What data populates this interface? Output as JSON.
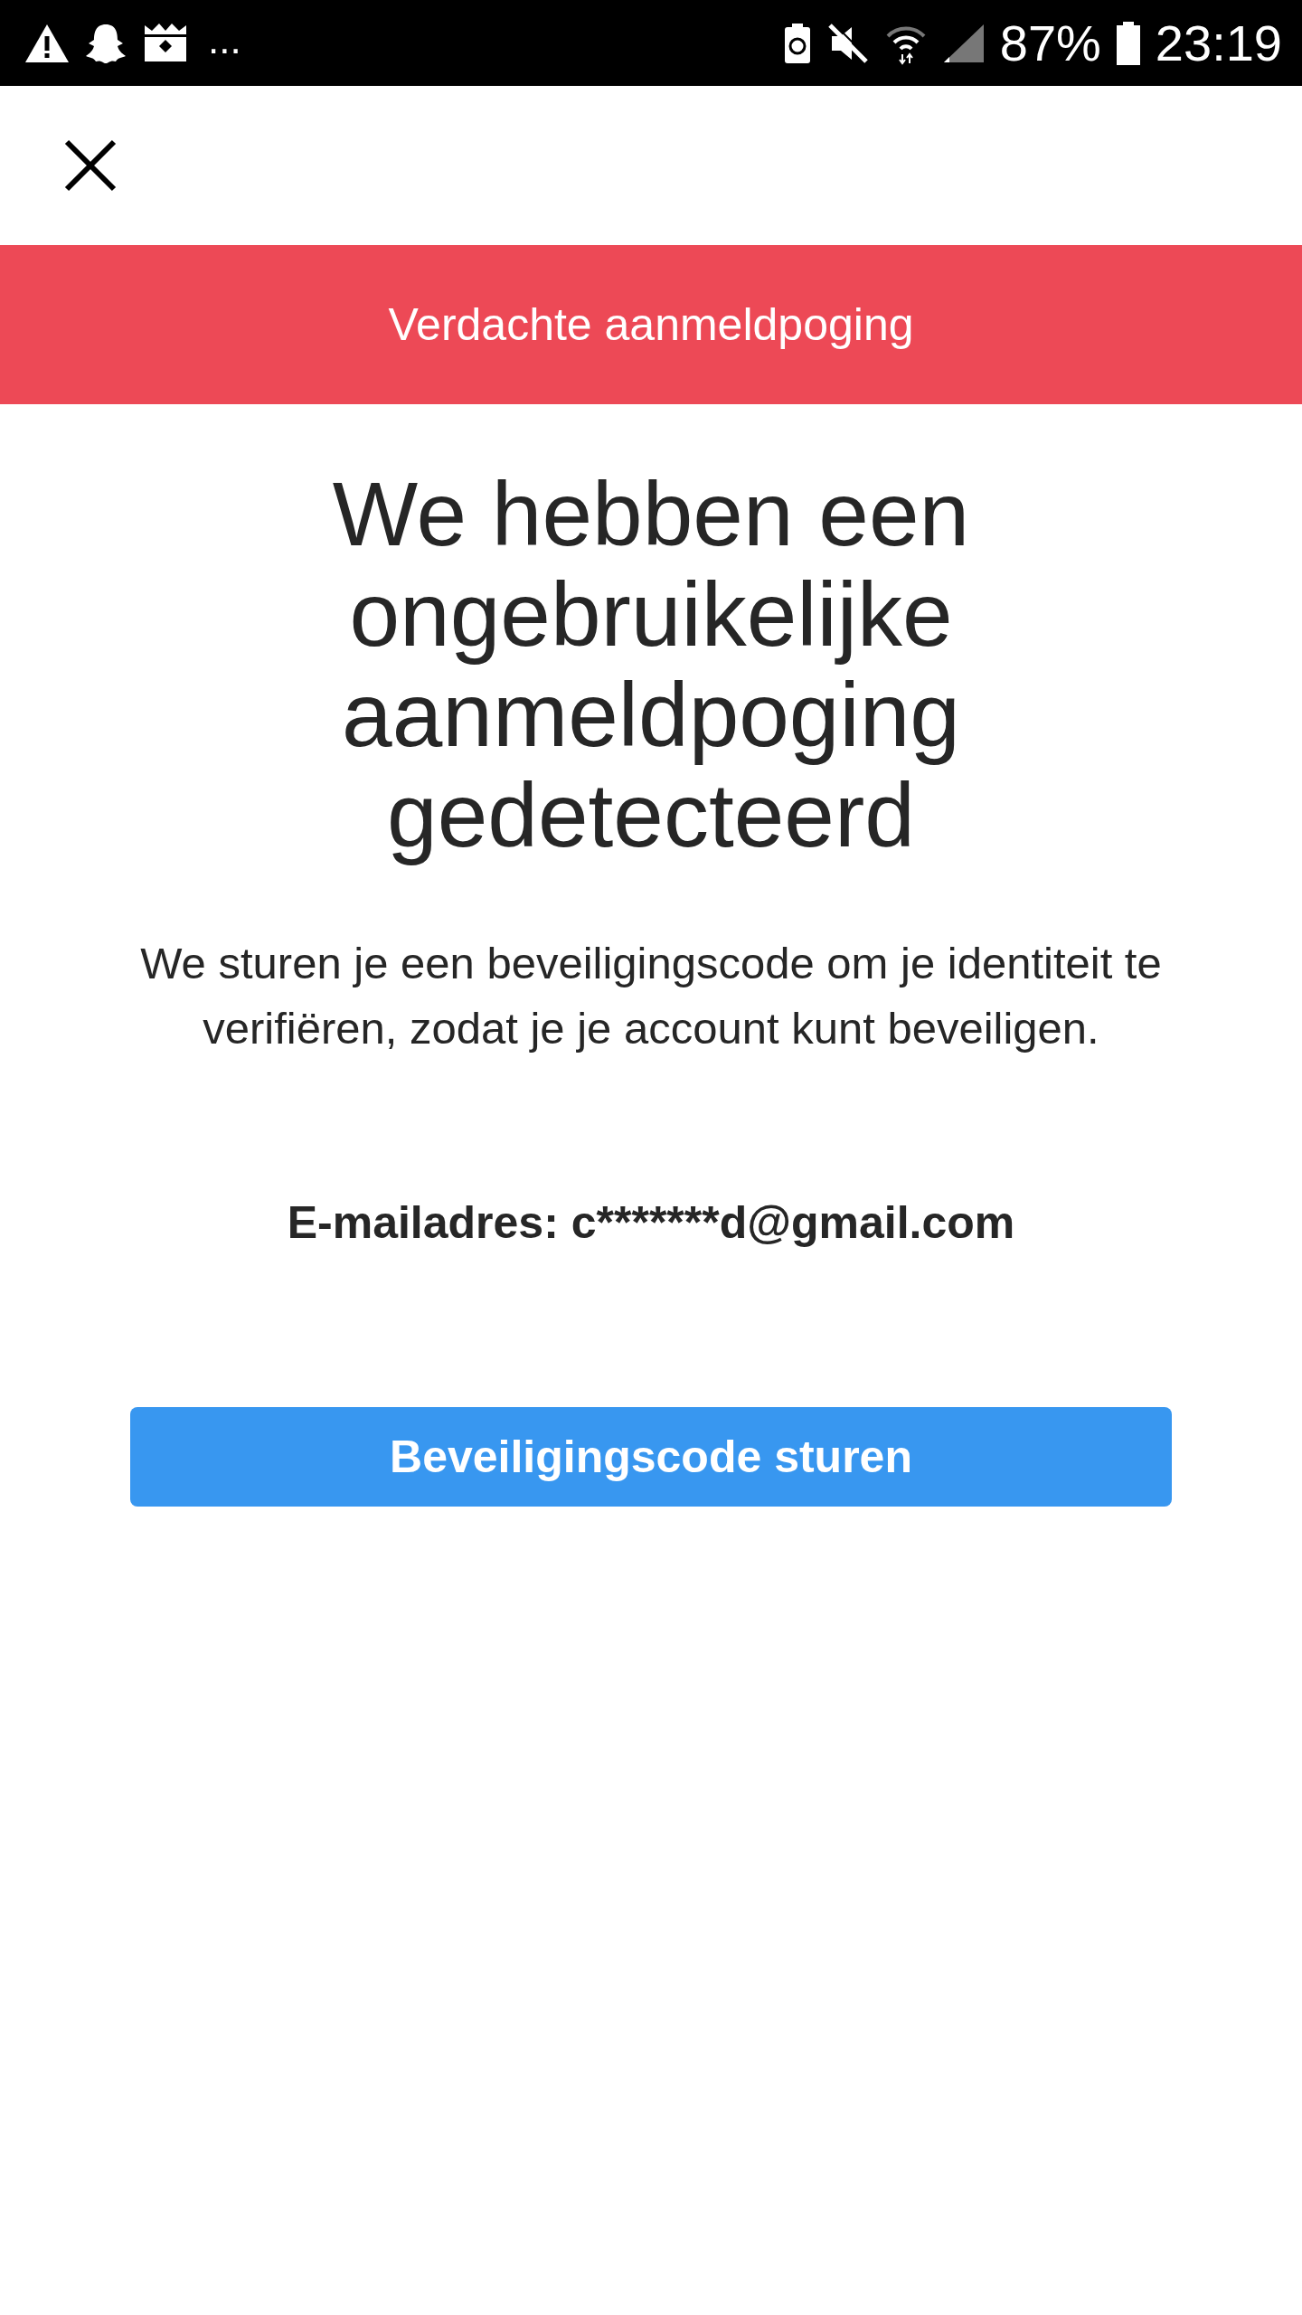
{
  "status_bar": {
    "more": "...",
    "battery": "87%",
    "time": "23:19"
  },
  "banner": {
    "text": "Verdachte aanmeldpoging"
  },
  "title": "We hebben een ongebruikelijke aanmeldpoging gedetecteerd",
  "body": "We sturen je een beveiligingscode om je identiteit te verifiëren, zodat je je account kunt beveiligen.",
  "email": "E-mailadres: c*******d@gmail.com",
  "button": "Beveiligingscode sturen"
}
